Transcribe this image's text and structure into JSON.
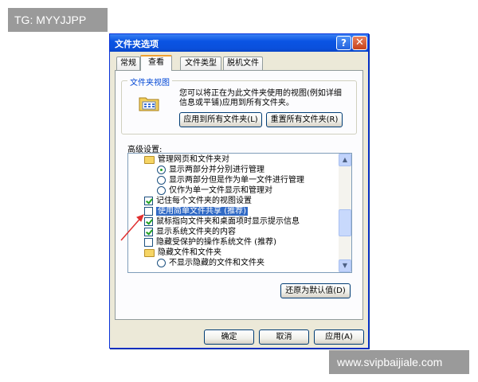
{
  "watermarks": {
    "top_left": "TG: MYYJJPP",
    "bottom_right": "www.svipbaijiale.com"
  },
  "window": {
    "title": "文件夹选项",
    "help_glyph": "?",
    "close_glyph": "✕"
  },
  "tabs": [
    {
      "label": "常规",
      "active": false
    },
    {
      "label": "查看",
      "active": true
    },
    {
      "label": "文件类型",
      "active": false
    },
    {
      "label": "脱机文件",
      "active": false
    }
  ],
  "folder_views": {
    "title": "文件夹视图",
    "icon": "folder-views-icon",
    "description": "您可以将正在为此文件夹使用的视图(例如详细信息或平铺)应用到所有文件夹。",
    "apply_button": "应用到所有文件夹(L)",
    "reset_button": "重置所有文件夹(R)"
  },
  "advanced": {
    "label": "高级设置:",
    "items": [
      {
        "type": "folder",
        "text": "管理网页和文件夹对",
        "checked": false
      },
      {
        "type": "radio",
        "text": "显示两部分并分别进行管理",
        "checked": true
      },
      {
        "type": "radio",
        "text": "显示两部分但是作为单一文件进行管理",
        "checked": false
      },
      {
        "type": "radio",
        "text": "仅作为单一文件显示和管理对",
        "checked": false
      },
      {
        "type": "check",
        "text": "记住每个文件夹的视图设置",
        "checked": true
      },
      {
        "type": "check",
        "text": "使用简单文件共享 (推荐)",
        "checked": false,
        "selected": true
      },
      {
        "type": "check",
        "text": "鼠标指向文件夹和桌面项时显示提示信息",
        "checked": true
      },
      {
        "type": "check",
        "text": "显示系统文件夹的内容",
        "checked": true
      },
      {
        "type": "check",
        "text": "隐藏受保护的操作系统文件 (推荐)",
        "checked": false
      },
      {
        "type": "folder",
        "text": "隐藏文件和文件夹",
        "checked": false
      },
      {
        "type": "radio",
        "text": "不显示隐藏的文件和文件夹",
        "checked": false
      }
    ],
    "restore_button": "还原为默认值(D)"
  },
  "footer": {
    "ok": "确定",
    "cancel": "取消",
    "apply": "应用(A)"
  },
  "colors": {
    "accent": "#0a54e3",
    "selection": "#316ac5",
    "annotation": "#e03030"
  }
}
